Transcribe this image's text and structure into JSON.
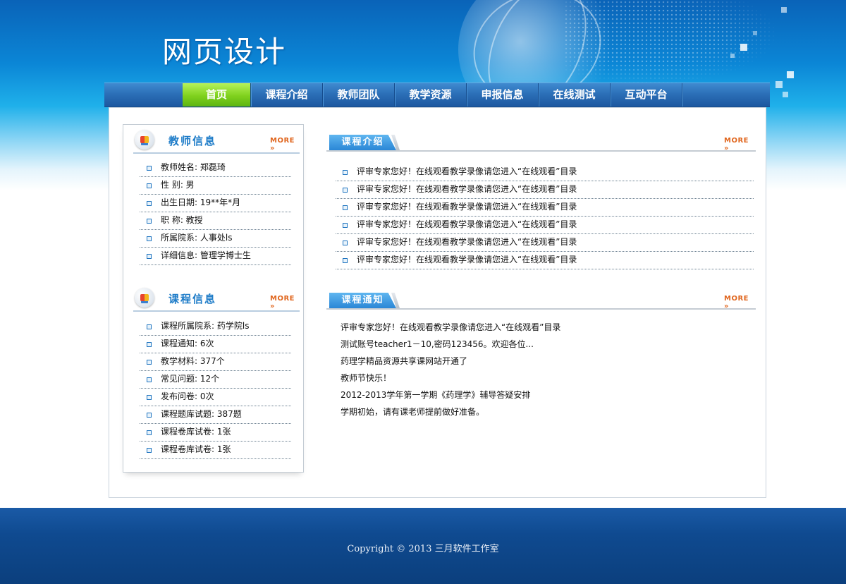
{
  "header": {
    "title": "网页设计"
  },
  "nav": {
    "items": [
      {
        "label": "首页",
        "active": true
      },
      {
        "label": "课程介绍"
      },
      {
        "label": "教师团队"
      },
      {
        "label": "教学资源"
      },
      {
        "label": "申报信息"
      },
      {
        "label": "在线测试"
      },
      {
        "label": "互动平台"
      }
    ]
  },
  "teacher_box": {
    "title": "教师信息",
    "more": "MORE",
    "items": [
      "教师姓名:  郑磊琦",
      "性    别:  男",
      "出生日期:  19**年*月",
      "职    称:  教授",
      "所属院系:  人事处ls",
      "详细信息:  管理学博士生"
    ]
  },
  "course_box": {
    "title": "课程信息",
    "more": "MORE",
    "items": [
      "课程所属院系:  药学院ls",
      "课程通知:  6次",
      "教学材料:  377个",
      "常见问题:  12个",
      "发布问卷:  0次",
      "课程题库试题:  387题",
      "课程卷库试卷:  1张",
      "课程卷库试卷:  1张"
    ]
  },
  "intro_section": {
    "tab": "课程介绍",
    "more": "MORE",
    "items": [
      "评审专家您好！在线观看教学录像请您进入“在线观看”目录",
      "评审专家您好！在线观看教学录像请您进入“在线观看”目录",
      "评审专家您好！在线观看教学录像请您进入“在线观看”目录",
      "评审专家您好！在线观看教学录像请您进入“在线观看”目录",
      "评审专家您好！在线观看教学录像请您进入“在线观看”目录",
      "评审专家您好！在线观看教学录像请您进入“在线观看”目录"
    ]
  },
  "notice_section": {
    "tab": "课程通知",
    "more": "MORE",
    "items": [
      "评审专家您好！在线观看教学录像请您进入“在线观看”目录",
      "测试账号teacher1－10,密码123456。欢迎各位...",
      "药理学精品资源共享课网站开通了",
      "教师节快乐！",
      "2012-2013学年第一学期《药理学》辅导答疑安排",
      "学期初始，请有课老师提前做好准备。"
    ]
  },
  "footer": {
    "copyright": "Copyright © 2013 三月软件工作室"
  }
}
